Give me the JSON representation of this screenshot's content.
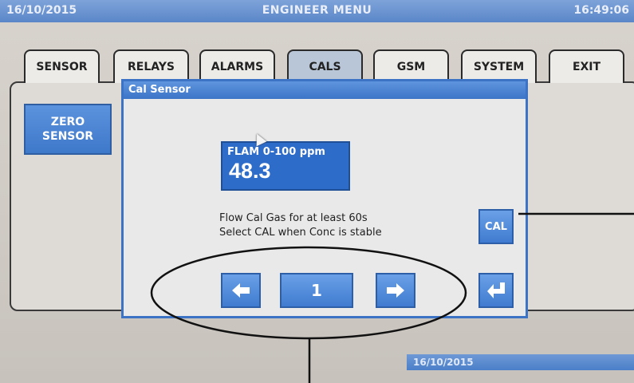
{
  "title_bar": {
    "date": "16/10/2015",
    "title": "ENGINEER MENU",
    "time": "16:49:06"
  },
  "tabs": [
    {
      "label": "SENSOR"
    },
    {
      "label": "RELAYS"
    },
    {
      "label": "ALARMS"
    },
    {
      "label": "CALS"
    },
    {
      "label": "GSM"
    },
    {
      "label": "SYSTEM"
    },
    {
      "label": "EXIT"
    }
  ],
  "active_tab": "CALS",
  "sidebar": {
    "zero_sensor_line1": "ZERO",
    "zero_sensor_line2": "SENSOR"
  },
  "dialog": {
    "title": "Cal Sensor",
    "conc_label": "FLAM 0-100 ppm",
    "conc_value": "48.3",
    "instruction_line1": "Flow Cal Gas for at least 60s",
    "instruction_line2": "Select CAL when Conc is stable",
    "cal_label": "CAL",
    "sensor_number": "1"
  },
  "lower_bar": {
    "date": "16/10/2015"
  },
  "icons": {
    "prev": "arrow-left-icon",
    "next": "arrow-right-icon",
    "enter": "enter-return-icon"
  },
  "colors": {
    "accent_blue": "#3f7bd0",
    "title_bar": "#5a86c8"
  }
}
